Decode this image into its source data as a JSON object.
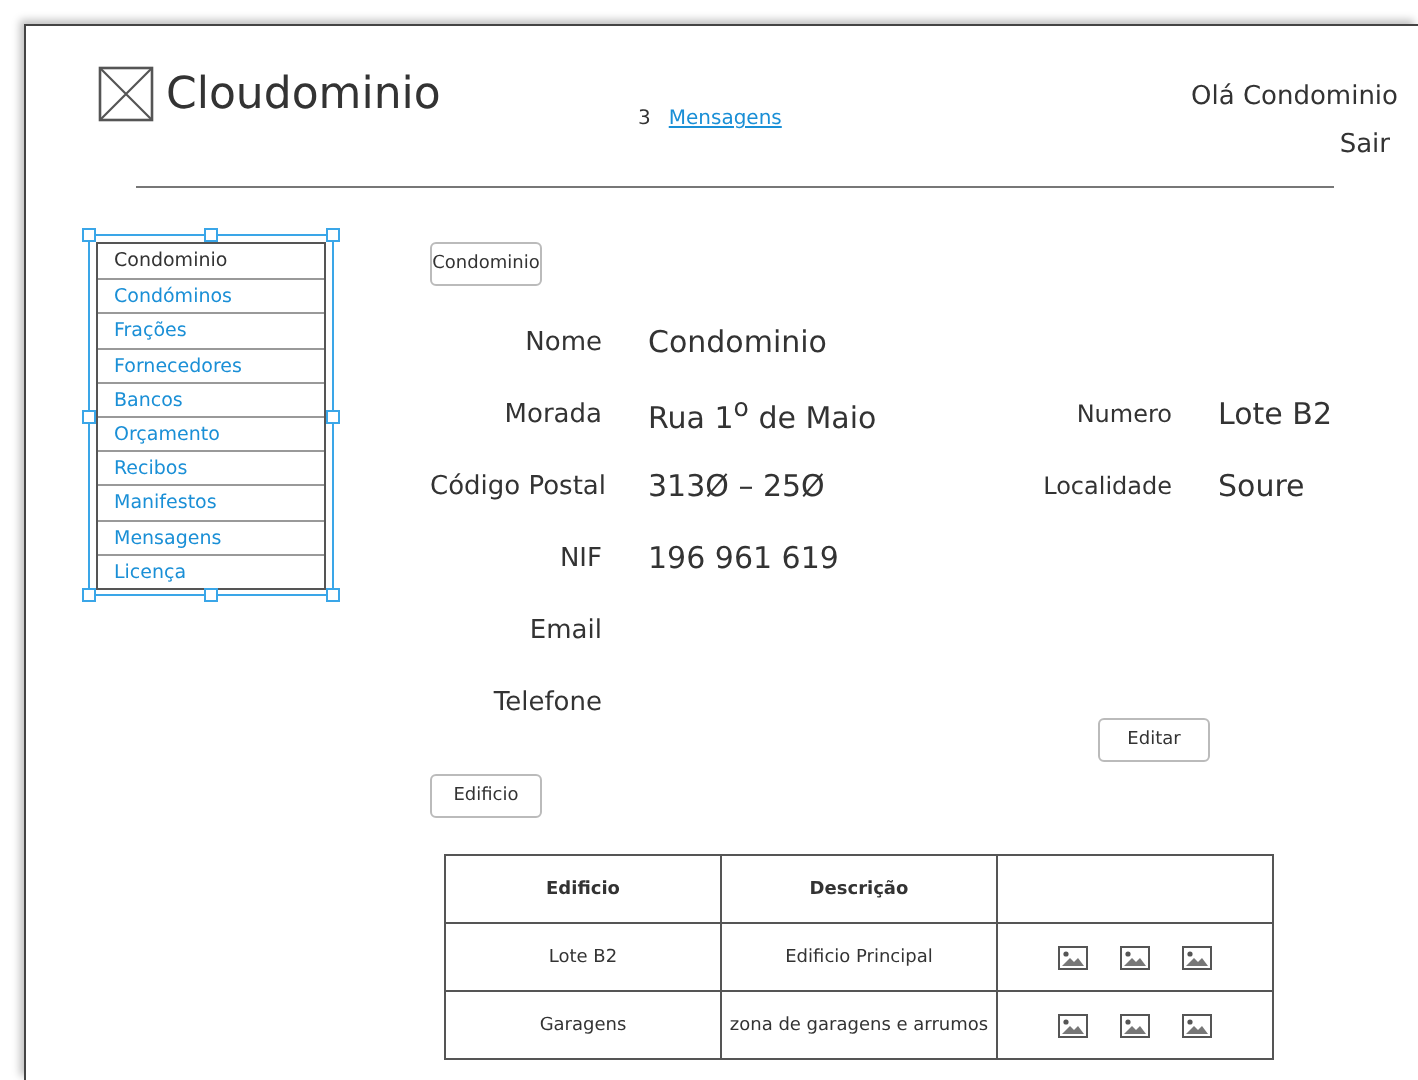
{
  "header": {
    "title": "Cloudominio",
    "message_count": "3",
    "messages_link": "Mensagens",
    "greeting": "Olá Condominio",
    "logout": "Sair"
  },
  "sidebar": {
    "items": [
      {
        "label": "Condominio",
        "selected": true
      },
      {
        "label": "Condóminos",
        "selected": false
      },
      {
        "label": "Frações",
        "selected": false
      },
      {
        "label": "Fornecedores",
        "selected": false
      },
      {
        "label": "Bancos",
        "selected": false
      },
      {
        "label": "Orçamento",
        "selected": false
      },
      {
        "label": "Recibos",
        "selected": false
      },
      {
        "label": "Manifestos",
        "selected": false
      },
      {
        "label": "Mensagens",
        "selected": false
      },
      {
        "label": "Licença",
        "selected": false
      }
    ]
  },
  "section_button": "Condominio",
  "form_rows": [
    {
      "left": {
        "label": "Nome",
        "value": "Condominio"
      }
    },
    {
      "left": {
        "label": "Morada",
        "value": "Rua 1$^{o}$ de Maio"
      },
      "right": {
        "label": "Numero",
        "value": "Lote B2"
      }
    },
    {
      "left": {
        "label": "Código Postal",
        "value": "313Ø – 25Ø"
      },
      "right": {
        "label": "Localidade",
        "value": "Soure"
      }
    },
    {
      "left": {
        "label": "NIF",
        "value": "196 961 619"
      }
    },
    {
      "left": {
        "label": "Email"
      }
    },
    {
      "left": {
        "label": "Telefone"
      }
    }
  ],
  "edit_button": "Editar",
  "building_button": "Edificio",
  "table": {
    "columns": [
      "Edificio",
      "Descrição"
    ],
    "rows": [
      {
        "cells": [
          "Lote B2",
          "Edificio Principal"
        ]
      },
      {
        "cells": [
          "Garagens",
          "zona de garagens e arrumos"
        ]
      }
    ]
  }
}
